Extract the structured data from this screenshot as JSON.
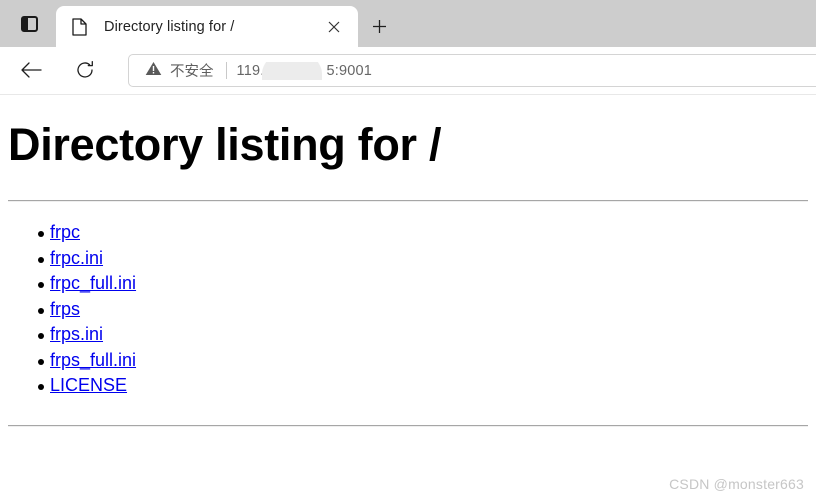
{
  "browser": {
    "vertical_tabs_icon": "vertical-tabs-icon",
    "tab": {
      "favicon": "document-icon",
      "title": "Directory listing for /",
      "close_icon": "close-icon"
    },
    "new_tab_icon": "plus-icon",
    "toolbar": {
      "back_icon": "back-arrow-icon",
      "reload_icon": "reload-icon",
      "security_icon": "warning-triangle-icon",
      "security_label": "不安全",
      "url_prefix": "119.",
      "url_suffix": "5:9001",
      "url_full": "119.      5:9001"
    }
  },
  "page": {
    "title": "Directory listing for /",
    "files": [
      {
        "name": "frpc"
      },
      {
        "name": "frpc.ini"
      },
      {
        "name": "frpc_full.ini"
      },
      {
        "name": "frps"
      },
      {
        "name": "frps.ini"
      },
      {
        "name": "frps_full.ini"
      },
      {
        "name": "LICENSE"
      }
    ]
  },
  "watermark": "CSDN @monster663",
  "colors": {
    "link": "#0000ee",
    "tabstrip": "#cdcdcd",
    "page_bg": "#ffffff",
    "rule": "#a6a6a6",
    "watermark": "#c6c6c6"
  }
}
